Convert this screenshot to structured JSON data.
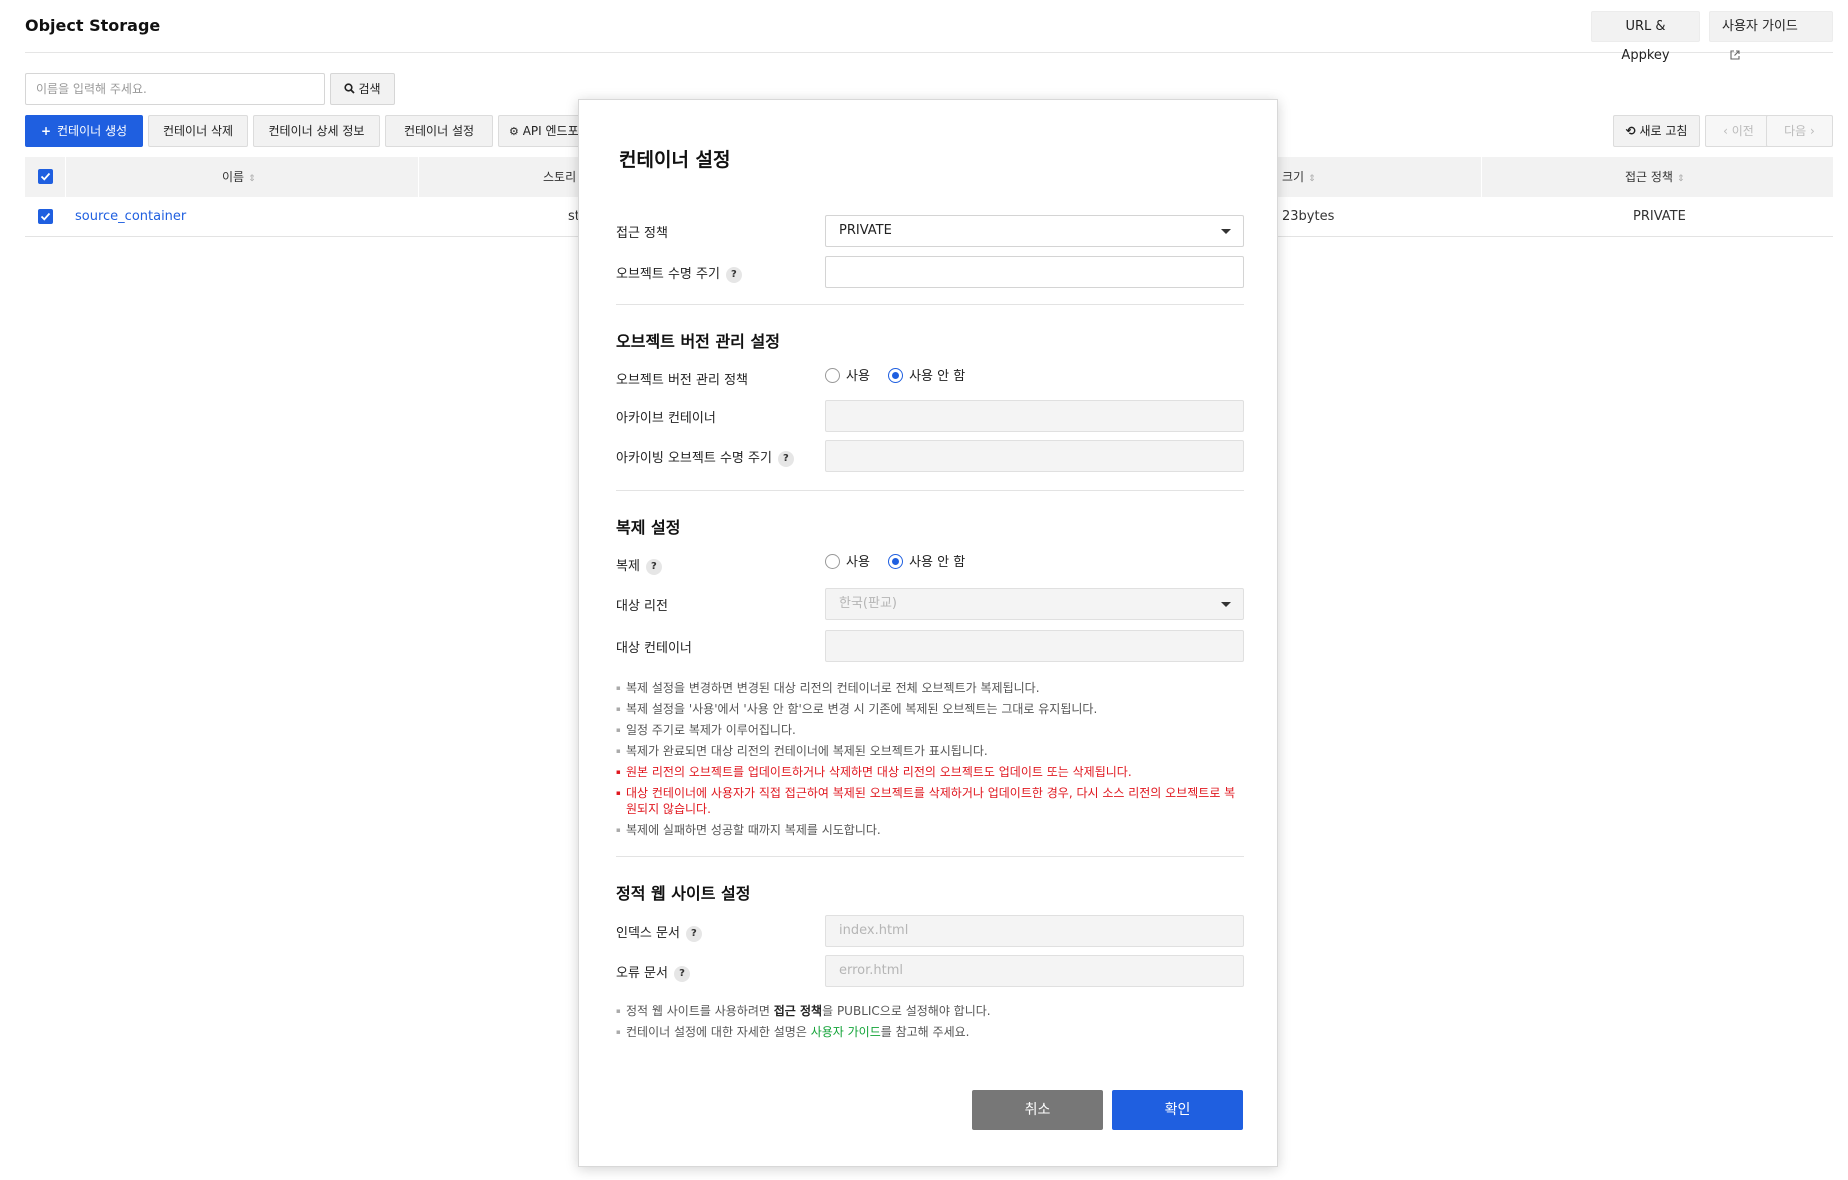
{
  "header": {
    "title": "Object Storage",
    "url_appkey_label": "URL & Appkey",
    "user_guide_label": "사용자 가이드"
  },
  "search": {
    "placeholder": "이름을 입력해 주세요.",
    "button_label": "검색"
  },
  "toolbar": {
    "create_label": "컨테이너 생성",
    "delete_label": "컨테이너 삭제",
    "detail_label": "컨테이너 상세 정보",
    "settings_label": "컨테이너 설정",
    "api_label": "API 엔드포",
    "refresh_label": "새로 고침",
    "prev_label": "이전",
    "next_label": "다음"
  },
  "table": {
    "columns": [
      "이름",
      "스토리",
      "크기",
      "접근 정책"
    ],
    "rows": [
      {
        "name": "source_container",
        "storage": "st",
        "size": "23bytes",
        "policy": "PRIVATE"
      }
    ]
  },
  "modal": {
    "title": "컨테이너 설정",
    "access_policy_label": "접근 정책",
    "access_policy_value": "PRIVATE",
    "object_lifecycle_label": "오브젝트 수명 주기",
    "versioning": {
      "title": "오브젝트 버전 관리 설정",
      "policy_label": "오브젝트 버전 관리 정책",
      "use_label": "사용",
      "not_use_label": "사용 안 함",
      "archive_container_label": "아카이브 컨테이너",
      "archive_lifecycle_label": "아카이빙 오브젝트 수명 주기"
    },
    "replication": {
      "title": "복제 설정",
      "label": "복제",
      "use_label": "사용",
      "not_use_label": "사용 안 함",
      "target_region_label": "대상 리전",
      "target_region_value": "한국(판교)",
      "target_container_label": "대상 컨테이너",
      "notes": [
        "복제 설정을 변경하면 변경된 대상 리전의 컨테이너로 전체 오브젝트가 복제됩니다.",
        "복제 설정을 '사용'에서 '사용 안 함'으로 변경 시 기존에 복제된 오브젝트는 그대로 유지됩니다.",
        "일정 주기로 복제가 이루어집니다.",
        "복제가 완료되면 대상 리전의 컨테이너에 복제된 오브젝트가 표시됩니다.",
        "원본 리전의 오브젝트를 업데이트하거나 삭제하면 대상 리전의 오브젝트도 업데이트 또는 삭제됩니다.",
        "대상 컨테이너에 사용자가 직접 접근하여 복제된 오브젝트를 삭제하거나 업데이트한 경우, 다시 소스 리전의 오브젝트로 복원되지 않습니다.",
        "복제에 실패하면 성공할 때까지 복제를 시도합니다."
      ]
    },
    "static_web": {
      "title": "정적 웹 사이트 설정",
      "index_label": "인덱스 문서",
      "index_placeholder": "index.html",
      "error_label": "오류 문서",
      "error_placeholder": "error.html",
      "note1_pre": "정적 웹 사이트를 사용하려면 ",
      "note1_bold": "접근 정책",
      "note1_post": "을 PUBLIC으로 설정해야 합니다.",
      "note2_pre": "컨테이너 설정에 대한 자세한 설명은 ",
      "note2_link": "사용자 가이드",
      "note2_post": "를 참고해 주세요."
    },
    "cancel_label": "취소",
    "confirm_label": "확인"
  },
  "colors": {
    "primary": "#1f5fe0",
    "danger": "#e0171f",
    "link_green": "#13a338"
  }
}
